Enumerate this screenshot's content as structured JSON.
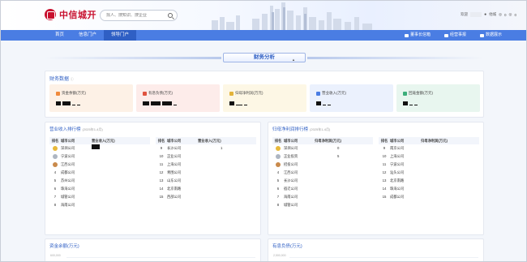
{
  "header": {
    "logo_text": "中信城开",
    "search_placeholder": "找人、搜知识、搜企业",
    "user_greeting": "欢迎",
    "user_role": "他城",
    "badge_a": "0",
    "badge_b": "0"
  },
  "nav": {
    "items": [
      {
        "label": "首页",
        "active": false
      },
      {
        "label": "信息门户",
        "active": false
      },
      {
        "label": "领导门户",
        "active": true
      }
    ],
    "right_items": [
      "董事长信箱",
      "经营事报",
      "数据展示"
    ]
  },
  "section": {
    "title": "财务分析"
  },
  "finance": {
    "title": "财务数据",
    "kpis": [
      {
        "label": "资金余额(万元)",
        "color": "#f08a3c",
        "bg": "#fdf1e6"
      },
      {
        "label": "有息负债(万元)",
        "color": "#e0523f",
        "bg": "#fdecea"
      },
      {
        "label": "归母净利润(万元)",
        "color": "#e3b33a",
        "bg": "#fdf7e5"
      },
      {
        "label": "营业收入(万元)",
        "color": "#4a7de3",
        "bg": "#ebf1fd"
      },
      {
        "label": "回笼金额(万元)",
        "color": "#3cae7a",
        "bg": "#e8f6ef"
      }
    ]
  },
  "revenue_rank": {
    "title": "营业收入排行榜",
    "subtitle": "(2025年1-4月)",
    "headers": [
      "排名",
      "城市公司",
      "营业收入(万元)"
    ],
    "left_rows": [
      {
        "rank": "1",
        "city": "深圳公司",
        "medal": "gold"
      },
      {
        "rank": "2",
        "city": "宁波公司",
        "medal": "silver"
      },
      {
        "rank": "3",
        "city": "江西公司",
        "medal": "bronze"
      },
      {
        "rank": "4",
        "city": "成都公司",
        "medal": ""
      },
      {
        "rank": "5",
        "city": "苏州公司",
        "medal": ""
      },
      {
        "rank": "6",
        "city": "珠海公司",
        "medal": ""
      },
      {
        "rank": "7",
        "city": "城管公司",
        "medal": ""
      },
      {
        "rank": "8",
        "city": "海南公司",
        "medal": ""
      }
    ],
    "right_rows": [
      {
        "rank": "9",
        "city": "长沙公司",
        "value": "1"
      },
      {
        "rank": "10",
        "city": "正业公司",
        "value": ""
      },
      {
        "rank": "11",
        "city": "上海公司",
        "value": ""
      },
      {
        "rank": "12",
        "city": "青围公司",
        "value": ""
      },
      {
        "rank": "13",
        "city": "山东公司",
        "value": ""
      },
      {
        "rank": "14",
        "city": "北京南路",
        "value": ""
      },
      {
        "rank": "15",
        "city": "西部公司",
        "value": ""
      }
    ]
  },
  "profit_rank": {
    "title": "归母净利润排行榜",
    "subtitle": "(2025年1-4月)",
    "headers": [
      "排名",
      "城市公司",
      "归母净利润(万元)"
    ],
    "left_rows": [
      {
        "rank": "1",
        "city": "深圳公司",
        "value": "0",
        "medal": "gold"
      },
      {
        "rank": "2",
        "city": "正业投资",
        "value": "5",
        "medal": "silver"
      },
      {
        "rank": "3",
        "city": "招投公司",
        "value": "",
        "medal": "bronze"
      },
      {
        "rank": "4",
        "city": "江西公司",
        "value": "",
        "medal": ""
      },
      {
        "rank": "5",
        "city": "长沙公司",
        "value": "",
        "medal": ""
      },
      {
        "rank": "6",
        "city": "宿迁公司",
        "value": "",
        "medal": ""
      },
      {
        "rank": "7",
        "city": "海南公司",
        "value": "",
        "medal": ""
      },
      {
        "rank": "8",
        "city": "城管公司",
        "value": "",
        "medal": ""
      }
    ],
    "right_rows": [
      {
        "rank": "9",
        "city": "南京公司"
      },
      {
        "rank": "10",
        "city": "上海公司"
      },
      {
        "rank": "11",
        "city": "宁波公司"
      },
      {
        "rank": "12",
        "city": "汕头公司"
      },
      {
        "rank": "13",
        "city": "北京南路"
      },
      {
        "rank": "14",
        "city": "珠海公司"
      },
      {
        "rank": "15",
        "city": "成都公司"
      }
    ]
  },
  "bottom": {
    "left_title": "资金余额(万元)",
    "left_axis": "600,000",
    "right_title": "有息负债(万元)",
    "right_axis": "2,500,000"
  }
}
